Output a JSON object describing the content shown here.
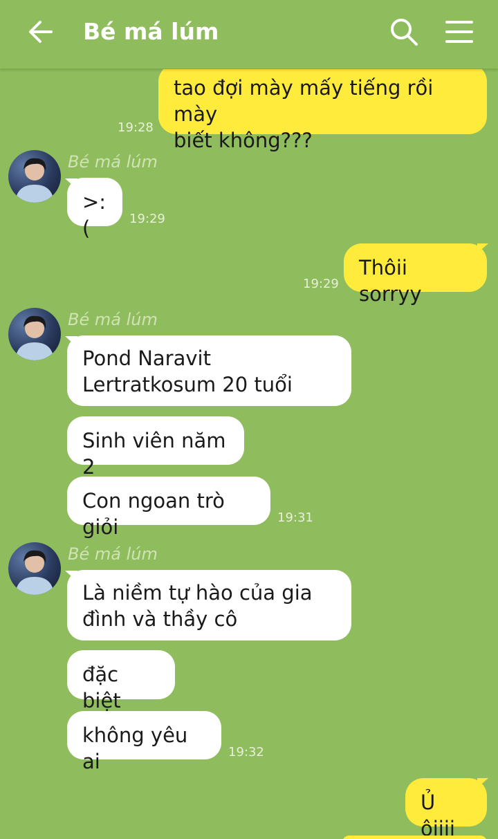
{
  "header": {
    "back_icon": "arrow-left-icon",
    "title": "Bé má lúm",
    "search_icon": "search-icon",
    "menu_icon": "hamburger-menu-icon"
  },
  "messages": [
    {
      "from": "me",
      "text": "tao đợi mày mấy tiếng rồi mày\nbiết không???",
      "time": "19:28"
    },
    {
      "from": "them",
      "sender": "Bé má lúm",
      "text": ">:(",
      "time": "19:29"
    },
    {
      "from": "me",
      "text": "Thôii sorryy",
      "time": "19:29"
    },
    {
      "from": "them",
      "sender": "Bé má lúm",
      "text": "Pond Naravit\nLertratkosum 20 tuổi"
    },
    {
      "from": "them",
      "text": "Sinh viên năm 2"
    },
    {
      "from": "them",
      "text": "Con ngoan trò giỏi",
      "time": "19:31"
    },
    {
      "from": "them",
      "sender": "Bé má lúm",
      "text": "Là niềm tự hào của gia\nđình và thầy cô"
    },
    {
      "from": "them",
      "text": "đặc biệt"
    },
    {
      "from": "them",
      "text": "không yêu ai",
      "time": "19:32"
    },
    {
      "from": "me",
      "text": "Ủ ôiiii"
    }
  ],
  "colors": {
    "background": "#8fbc5c",
    "my_bubble": "#ffeb3b",
    "their_bubble": "#ffffff"
  }
}
